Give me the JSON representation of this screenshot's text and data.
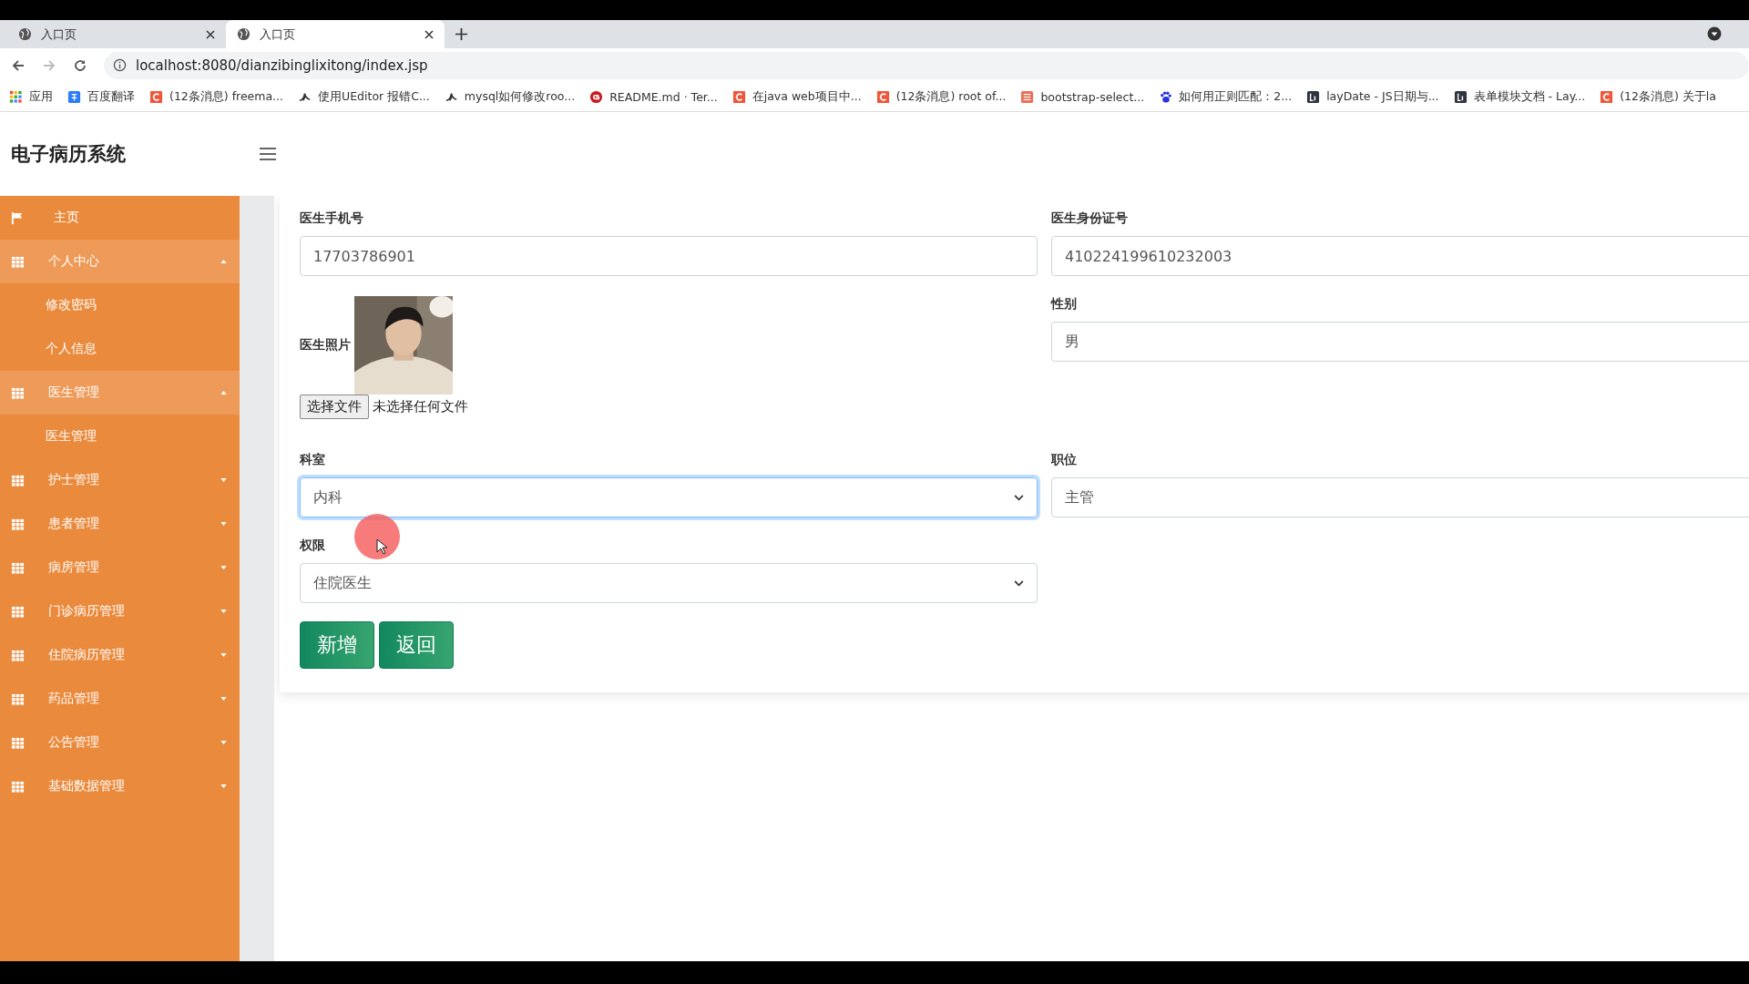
{
  "browser": {
    "tabs": [
      {
        "title": "入口页",
        "selected": false
      },
      {
        "title": "入口页",
        "selected": true
      }
    ],
    "address": "localhost:8080/dianzibinglixitong/index.jsp",
    "bookmarks": [
      {
        "kind": "apps",
        "label": "应用"
      },
      {
        "kind": "translate",
        "label": "百度翻译"
      },
      {
        "kind": "csdn",
        "label": "(12条消息) freema..."
      },
      {
        "kind": "yuque",
        "label": "使用UEditor 报错C..."
      },
      {
        "kind": "yuque",
        "label": "mysql如何修改roo..."
      },
      {
        "kind": "gitee",
        "label": "README.md · Ter..."
      },
      {
        "kind": "csdn",
        "label": "在java web项目中..."
      },
      {
        "kind": "csdn",
        "label": "(12条消息) root of..."
      },
      {
        "kind": "jianshu",
        "label": "bootstrap-select..."
      },
      {
        "kind": "baidu",
        "label": "如何用正则匹配：2..."
      },
      {
        "kind": "layui",
        "label": "layDate - JS日期与..."
      },
      {
        "kind": "layui",
        "label": "表单模块文档 - Lay..."
      },
      {
        "kind": "csdn",
        "label": "(12条消息) 关于la"
      }
    ]
  },
  "header": {
    "title": "电子病历系统"
  },
  "sidebar": {
    "items": [
      {
        "kind": "home",
        "label": "主页"
      },
      {
        "kind": "group",
        "label": "个人中心",
        "expanded": true,
        "children": [
          {
            "label": "修改密码"
          },
          {
            "label": "个人信息"
          }
        ]
      },
      {
        "kind": "group",
        "label": "医生管理",
        "expanded": true,
        "children": [
          {
            "label": "医生管理"
          }
        ]
      },
      {
        "kind": "group",
        "label": "护士管理",
        "expanded": false
      },
      {
        "kind": "group",
        "label": "患者管理",
        "expanded": false
      },
      {
        "kind": "group",
        "label": "病房管理",
        "expanded": false
      },
      {
        "kind": "group",
        "label": "门诊病历管理",
        "expanded": false
      },
      {
        "kind": "group",
        "label": "住院病历管理",
        "expanded": false
      },
      {
        "kind": "group",
        "label": "药品管理",
        "expanded": false
      },
      {
        "kind": "group",
        "label": "公告管理",
        "expanded": false
      },
      {
        "kind": "group",
        "label": "基础数据管理",
        "expanded": false
      }
    ]
  },
  "form": {
    "rows": [
      [
        {
          "kind": "text",
          "label": "医生手机号",
          "value": "17703786901"
        },
        {
          "kind": "text",
          "label": "医生身份证号",
          "value": "410224199610232003"
        }
      ],
      [
        {
          "label": "医生照片",
          "button": "选择文件",
          "status": "未选择任何文件"
        },
        {
          "kind": "text",
          "label": "性别",
          "value": "男"
        }
      ],
      [
        {
          "kind": "select",
          "label": "科室",
          "value": "内科",
          "focused": true
        },
        {
          "kind": "text",
          "label": "职位",
          "value": "主管"
        }
      ],
      [
        {
          "kind": "select",
          "label": "权限",
          "value": "住院医生",
          "focused": false
        }
      ]
    ],
    "buttons": [
      "新增",
      "返回"
    ]
  }
}
